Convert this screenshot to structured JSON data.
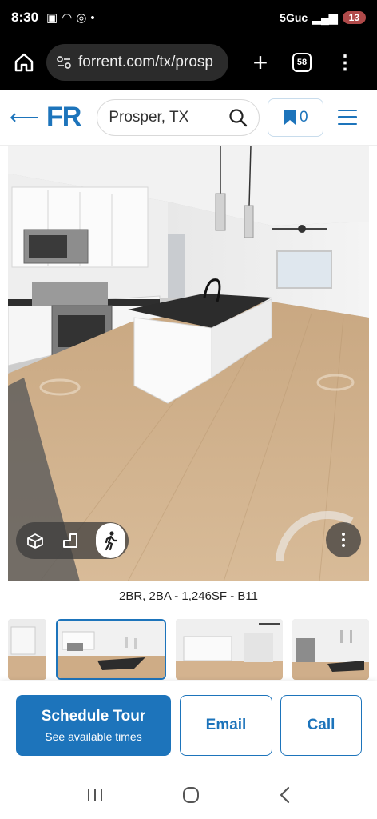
{
  "status_bar": {
    "time": "8:30",
    "network": "5Guc",
    "battery": "13"
  },
  "browser": {
    "url": "forrent.com/tx/prosp",
    "tab_count": "58"
  },
  "header": {
    "logo": "FR",
    "search_value": "Prosper, TX",
    "saved_count": "0"
  },
  "viewer": {
    "caption": "2BR, 2BA - 1,246SF - B11"
  },
  "actions": {
    "schedule_title": "Schedule Tour",
    "schedule_sub": "See available times",
    "email": "Email",
    "call": "Call"
  },
  "colors": {
    "brand": "#1d74bb"
  }
}
